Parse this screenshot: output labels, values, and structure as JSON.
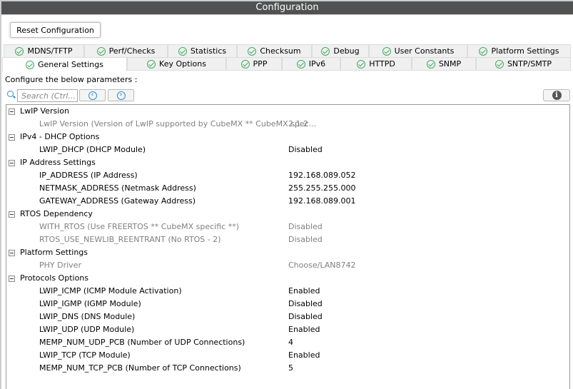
{
  "title": "Configuration",
  "reset_label": "Reset Configuration",
  "tabs_row1": [
    "MDNS/TFTP",
    "Perf/Checks",
    "Statistics",
    "Checksum",
    "Debug",
    "User Constants",
    "Platform Settings"
  ],
  "tabs_row2": [
    "General Settings",
    "Key Options",
    "PPP",
    "IPv6",
    "HTTPD",
    "SNMP",
    "SNTP/SMTP"
  ],
  "selected_tab": "General Settings",
  "configure_text": "Configure the below parameters :",
  "search_placeholder": "Search (Ctrl...",
  "tree": [
    {
      "type": "group",
      "label": "LwIP Version"
    },
    {
      "type": "item",
      "label": "LwIP Version (Version of LwIP supported by CubeMX ** CubeMX spec...",
      "value": "2.1.2",
      "dim": true
    },
    {
      "type": "group",
      "label": "IPv4 - DHCP Options"
    },
    {
      "type": "item",
      "label": "LWIP_DHCP (DHCP Module)",
      "value": "Disabled"
    },
    {
      "type": "group",
      "label": "IP Address Settings"
    },
    {
      "type": "item",
      "label": "IP_ADDRESS (IP Address)",
      "value": "192.168.089.052"
    },
    {
      "type": "item",
      "label": "NETMASK_ADDRESS (Netmask Address)",
      "value": "255.255.255.000"
    },
    {
      "type": "item",
      "label": "GATEWAY_ADDRESS (Gateway Address)",
      "value": "192.168.089.001"
    },
    {
      "type": "group",
      "label": "RTOS Dependency"
    },
    {
      "type": "item",
      "label": "WITH_RTOS (Use FREERTOS ** CubeMX specific **)",
      "value": "Disabled",
      "dim": true
    },
    {
      "type": "item",
      "label": "RTOS_USE_NEWLIB_REENTRANT (No RTOS - 2)",
      "value": "Disabled",
      "dim": true
    },
    {
      "type": "group",
      "label": "Platform Settings"
    },
    {
      "type": "item",
      "label": "PHY Driver",
      "value": "Choose/LAN8742",
      "dim": true
    },
    {
      "type": "group",
      "label": "Protocols Options"
    },
    {
      "type": "item",
      "label": "LWIP_ICMP (ICMP Module Activation)",
      "value": "Enabled"
    },
    {
      "type": "item",
      "label": "LWIP_IGMP (IGMP Module)",
      "value": "Disabled"
    },
    {
      "type": "item",
      "label": "LWIP_DNS (DNS Module)",
      "value": "Disabled"
    },
    {
      "type": "item",
      "label": "LWIP_UDP (UDP Module)",
      "value": "Enabled"
    },
    {
      "type": "item",
      "label": "MEMP_NUM_UDP_PCB (Number of UDP Connections)",
      "value": "4"
    },
    {
      "type": "item",
      "label": "LWIP_TCP (TCP Module)",
      "value": "Enabled"
    },
    {
      "type": "item",
      "label": "MEMP_NUM_TCP_PCB (Number of TCP Connections)",
      "value": "5"
    }
  ]
}
